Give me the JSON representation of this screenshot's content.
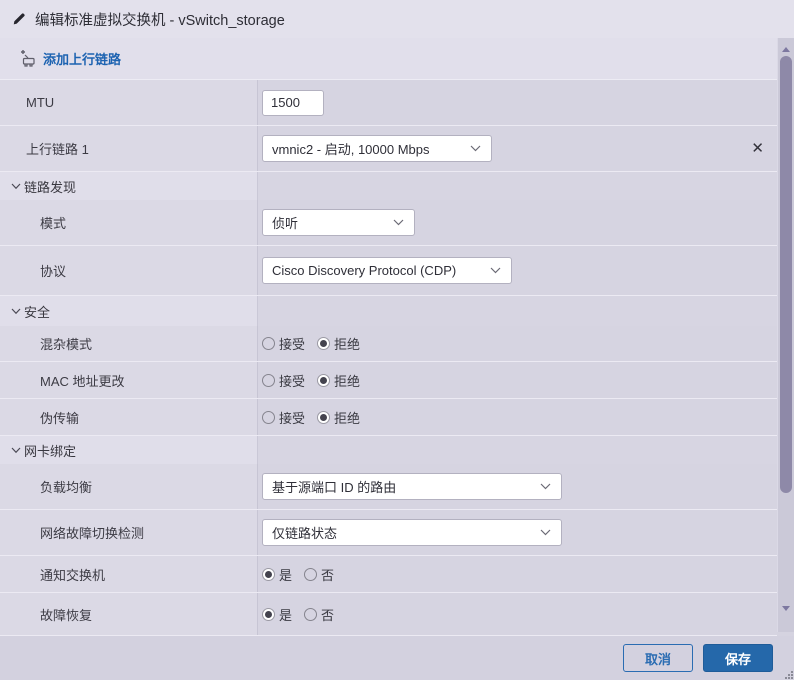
{
  "colors": {
    "accent_blue": "#2a6cb2",
    "save_button_bg": "#2568aa",
    "dialog_bg": "#d5d3e0",
    "selected_radio_dot": "#44434e"
  },
  "icons": {
    "title": "pencil-icon",
    "add_uplink": "nic-add-icon",
    "section_toggle": "chevron-down-icon",
    "select_arrow": "chevron-down-icon",
    "remove_uplink": "close-icon"
  },
  "dialog": {
    "title": "编辑标准虚拟交换机 - vSwitch_storage",
    "toolbar": {
      "add_uplink_label": "添加上行链路"
    },
    "form": {
      "mtu": {
        "label": "MTU",
        "value": "1500"
      },
      "uplink1": {
        "label": "上行链路 1",
        "selected_option": "vmnic2 - 启动, 10000 Mbps",
        "remove_glyph": "✕"
      },
      "link_discovery": {
        "title": "链路发现",
        "mode": {
          "label": "模式",
          "selected_option": "侦听"
        },
        "protocol": {
          "label": "协议",
          "selected_option": "Cisco Discovery Protocol (CDP)"
        }
      },
      "security": {
        "title": "安全",
        "promiscuous_mode": {
          "label": "混杂模式",
          "options": [
            "接受",
            "拒绝"
          ],
          "selected": "拒绝"
        },
        "mac_address_changes": {
          "label": "MAC 地址更改",
          "options": [
            "接受",
            "拒绝"
          ],
          "selected": "拒绝"
        },
        "forged_transmits": {
          "label": "伪传输",
          "options": [
            "接受",
            "拒绝"
          ],
          "selected": "拒绝"
        }
      },
      "nic_teaming": {
        "title": "网卡绑定",
        "load_balancing": {
          "label": "负载均衡",
          "selected_option": "基于源端口 ID 的路由"
        },
        "network_failover_detection": {
          "label": "网络故障切换检测",
          "selected_option": "仅链路状态"
        },
        "notify_switches": {
          "label": "通知交换机",
          "options": [
            "是",
            "否"
          ],
          "selected": "是"
        },
        "failback": {
          "label": "故障恢复",
          "options": [
            "是",
            "否"
          ],
          "selected": "是"
        }
      }
    },
    "footer": {
      "cancel_label": "取消",
      "save_label": "保存"
    }
  }
}
